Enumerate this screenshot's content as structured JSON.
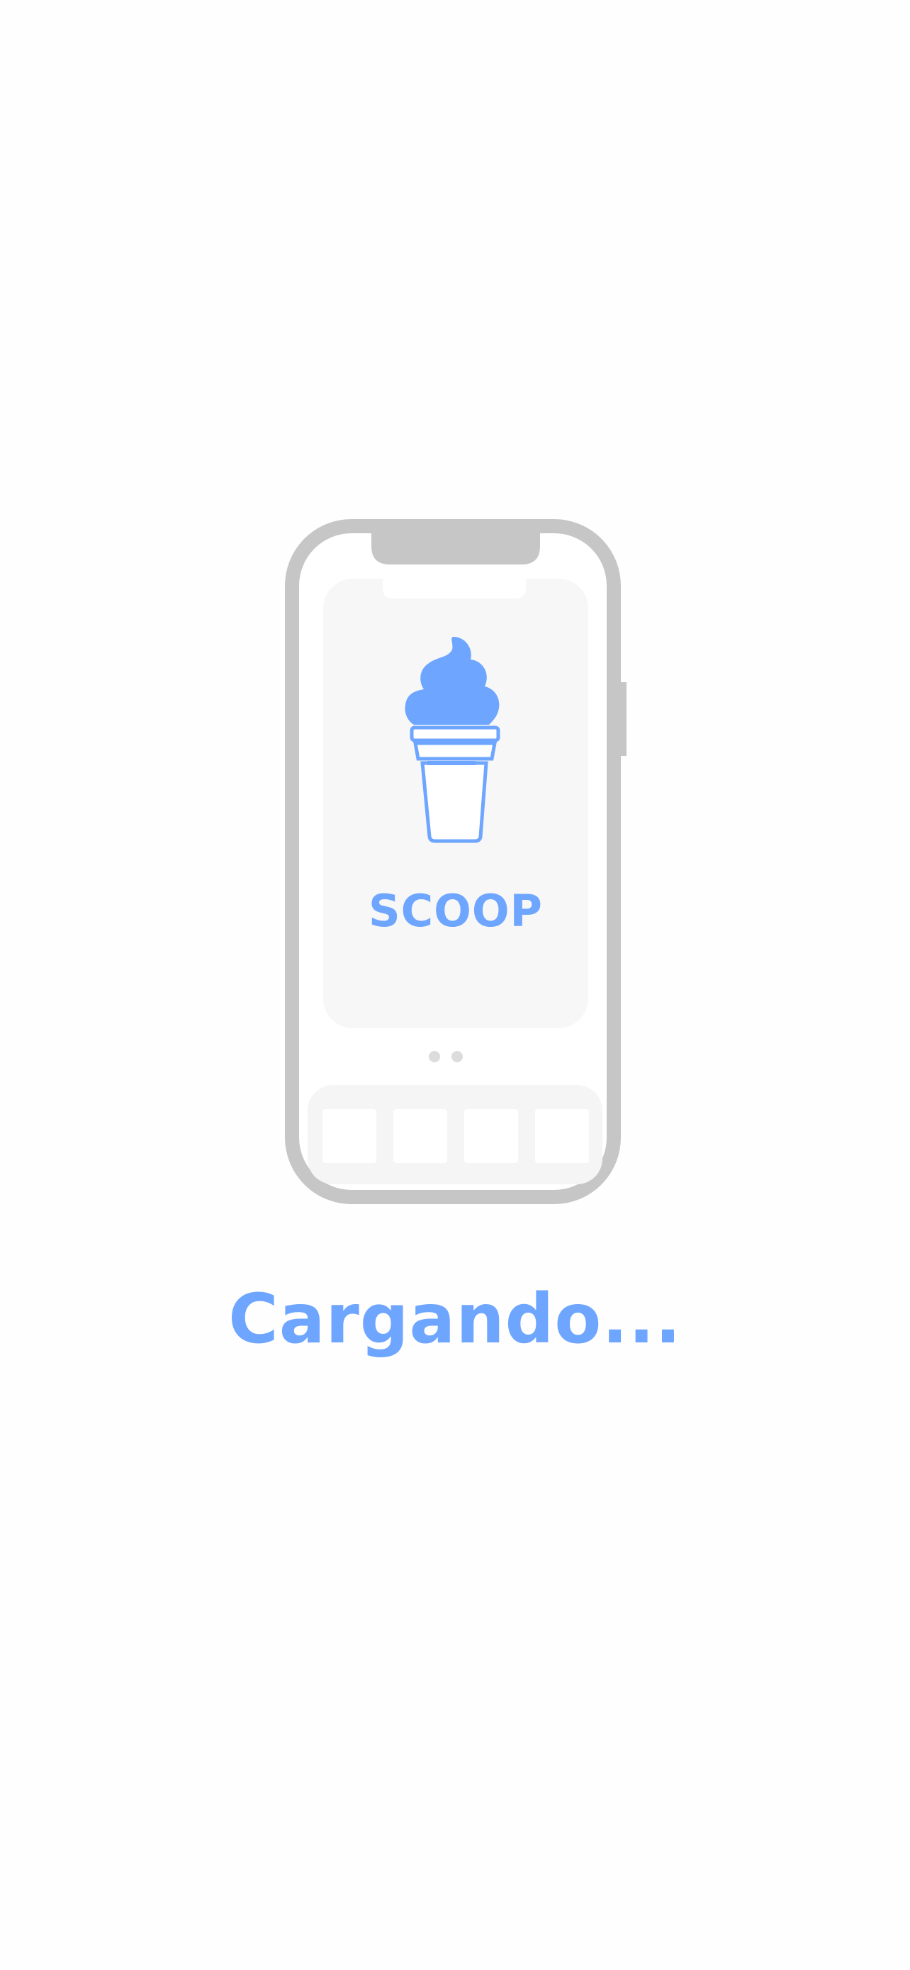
{
  "splash": {
    "app_name": "SCOOP",
    "loading_text": "Cargando...",
    "logo_icon": "ice-cream-cone-icon",
    "page_indicator_count": 2
  },
  "colors": {
    "background": "#fefefe",
    "accent": "#6ea6ff",
    "phone_frame": "#c6c6c6",
    "screen_card": "#f7f7f7",
    "dock": "#f5f5f5",
    "dock_tile": "#ffffff",
    "indicator_dot": "#dcdcdc"
  }
}
